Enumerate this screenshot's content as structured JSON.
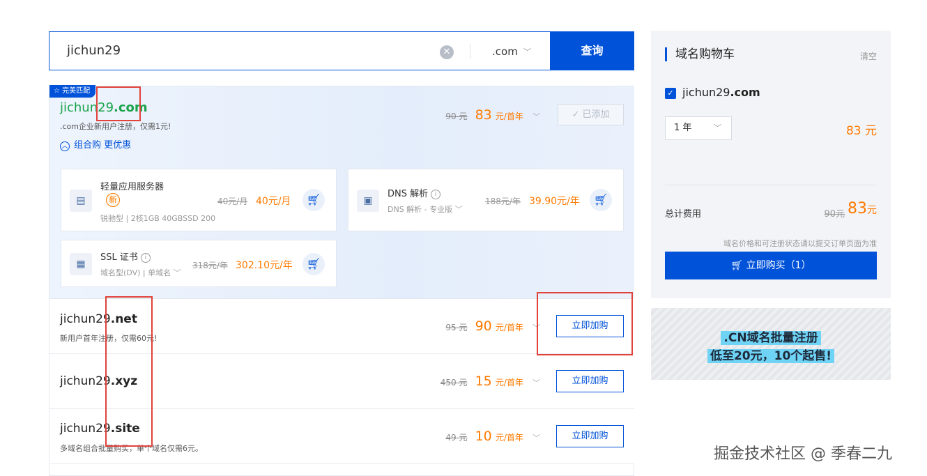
{
  "search": {
    "query": "jichun29",
    "clear_icon": "clear-icon",
    "suffix": ".com",
    "button": "查询"
  },
  "perfect_match": {
    "tag": "完美匹配",
    "domain_name": "jichun29",
    "domain_suffix": ".com",
    "subtitle": ".com企业新用户注册，仅需1元!",
    "combo_link": "组合购 更优惠",
    "old_price": "90 元",
    "new_price": "83",
    "unit": "元/首年",
    "added_label": "✓ 已添加"
  },
  "bundle": [
    {
      "name": "轻量应用服务器",
      "badge": "新",
      "spec": "锐驰型 | 2核1GB 40GBSSD 200",
      "old": "40元/月",
      "new": "40元/月",
      "icon": "server-icon"
    },
    {
      "name": "DNS 解析",
      "spec": "DNS 解析 - 专业版",
      "old": "188元/年",
      "new": "39.90元/年",
      "icon": "dns-icon"
    },
    {
      "name": "SSL 证书",
      "spec": "域名型(DV) | 单域名",
      "old": "318元/年",
      "new": "302.10元/年",
      "icon": "ssl-icon"
    }
  ],
  "results": [
    {
      "name": "jichun29",
      "suffix": ".net",
      "subtitle": "新用户首年注册，仅需60元!",
      "old": "95 元",
      "new": "90",
      "unit": "元/首年",
      "button": "立即加购"
    },
    {
      "name": "jichun29",
      "suffix": ".xyz",
      "subtitle": "",
      "old": "450 元",
      "new": "15",
      "unit": "元/首年",
      "button": "立即加购"
    },
    {
      "name": "jichun29",
      "suffix": ".site",
      "subtitle": "多域名组合批量购买，单个域名仅需6元。",
      "old": "49 元",
      "new": "10",
      "unit": "元/首年",
      "button": "立即加购"
    }
  ],
  "cart": {
    "title": "域名购物车",
    "clear": "清空",
    "item_name": "jichun29",
    "item_suffix": ".com",
    "period": "1 年",
    "item_price": "83 元",
    "total_label": "总计费用",
    "total_old": "90元",
    "total_new": "83",
    "total_unit": "元",
    "note": "域名价格和可注册状态请以提交订单页面为准",
    "buy_button": "立即购买（1）"
  },
  "banner": {
    "line1": ".CN域名批量注册",
    "line2": "低至20元，10个起售!"
  },
  "watermark": "掘金技术社区 @ 季春二九",
  "colors": {
    "accent": "#0052d9",
    "price": "#ff7a00",
    "match_green": "#1aa34a",
    "highlight_box": "#e0433a"
  }
}
